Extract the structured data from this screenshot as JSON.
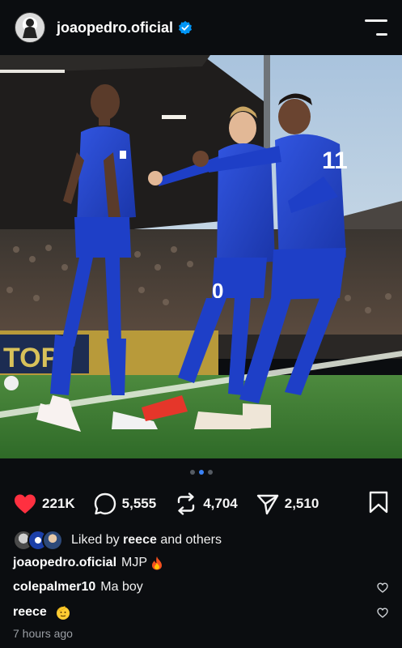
{
  "header": {
    "username": "joaopedro.oficial"
  },
  "carousel": {
    "count": 3,
    "active_index": 1
  },
  "actions": {
    "likes": "221K",
    "comments": "5,555",
    "reposts": "4,704",
    "shares": "2,510"
  },
  "liked_by": {
    "prefix": "Liked by",
    "user": "reece",
    "suffix": "and others"
  },
  "caption": {
    "user": "joaopedro.oficial",
    "text": "MJP"
  },
  "comments": [
    {
      "user": "colepalmer10",
      "text": "Ma boy"
    },
    {
      "user": "reece",
      "text": ""
    }
  ],
  "timestamp": "7 hours ago",
  "colors": {
    "like_red": "#ff3040",
    "verified_blue": "#0095f6",
    "active_dot": "#3b82f6",
    "kit_blue": "#1e3fc7"
  }
}
